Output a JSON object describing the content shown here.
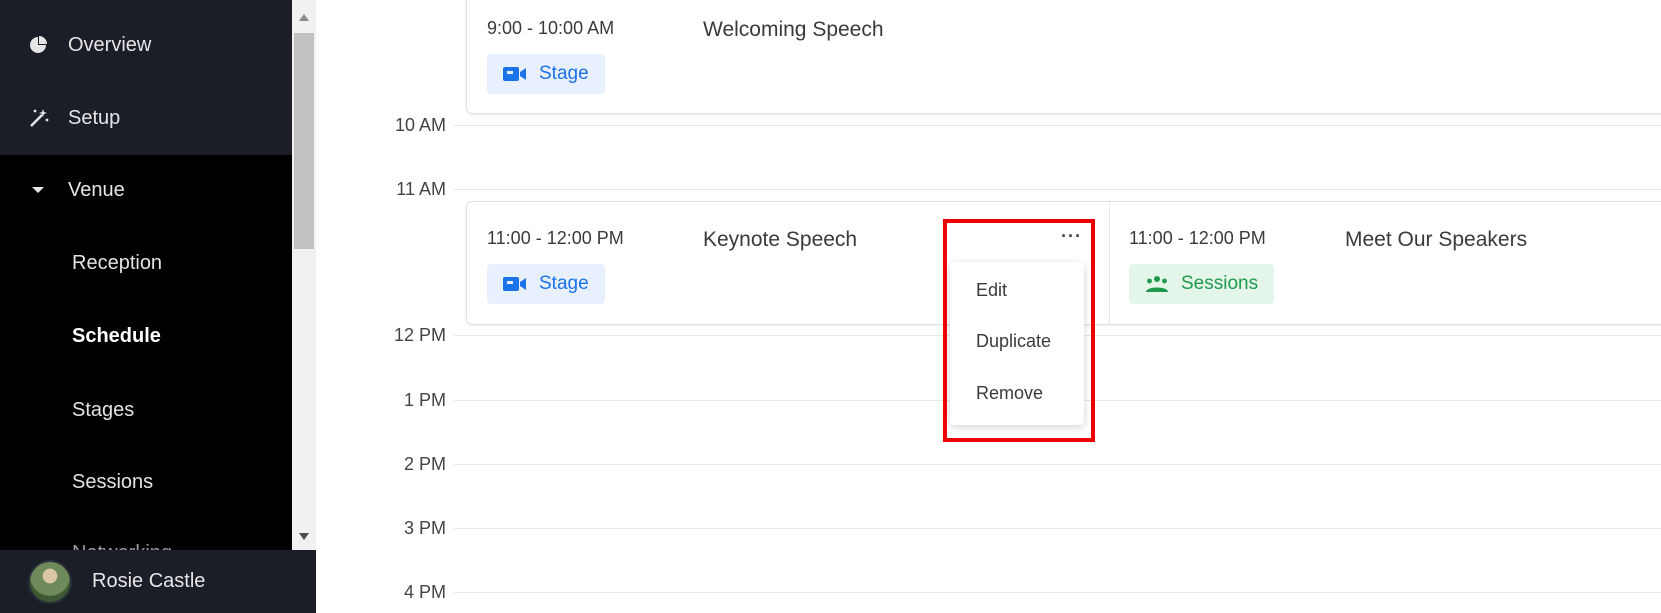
{
  "sidebar": {
    "items": [
      {
        "label": "Overview",
        "icon": "pie-chart-icon"
      },
      {
        "label": "Setup",
        "icon": "magic-wand-icon"
      },
      {
        "label": "Venue",
        "icon": "caret-down-icon"
      }
    ],
    "venue_sub": [
      "Reception",
      "Schedule",
      "Stages",
      "Sessions",
      "Networking"
    ],
    "active": "Schedule"
  },
  "user": {
    "name": "Rosie Castle"
  },
  "timeline": {
    "labels": [
      "10 AM",
      "11 AM",
      "12 PM",
      "1 PM",
      "2 PM",
      "3 PM",
      "4 PM"
    ]
  },
  "events": [
    {
      "time": "9:00 - 10:00 AM",
      "title": "Welcoming Speech",
      "tag": "Stage"
    },
    {
      "time": "11:00 - 12:00 PM",
      "title": "Keynote Speech",
      "tag": "Stage"
    },
    {
      "time": "11:00 - 12:00 PM",
      "title": "Meet Our Speakers",
      "tag": "Sessions"
    }
  ],
  "context_menu": {
    "trigger": "···",
    "items": [
      "Edit",
      "Duplicate",
      "Remove"
    ]
  },
  "colors": {
    "stage_accent": "#1a73e8",
    "sessions_accent": "#1e9a4a",
    "highlight": "#ee0000"
  }
}
